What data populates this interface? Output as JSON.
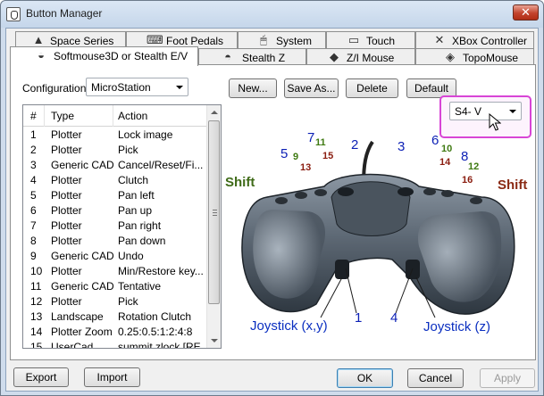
{
  "window": {
    "title": "Button Manager"
  },
  "tabs_row1": [
    {
      "label": "Space Series",
      "icon": "spacemouse-icon"
    },
    {
      "label": "Foot Pedals",
      "icon": "pedal-icon"
    },
    {
      "label": "System",
      "icon": "mouse-icon"
    },
    {
      "label": "Touch",
      "icon": "monitor-icon"
    },
    {
      "label": "XBox Controller",
      "icon": "gamepad-icon"
    }
  ],
  "tabs_row2": [
    {
      "label": "Softmouse3D or Stealth E/V",
      "icon": "softmouse-icon",
      "active": true
    },
    {
      "label": "Stealth Z",
      "icon": "stealth-icon"
    },
    {
      "label": "Z/I Mouse",
      "icon": "zi-mouse-icon"
    },
    {
      "label": "TopoMouse",
      "icon": "topomouse-icon"
    }
  ],
  "configuration": {
    "label": "Configuration",
    "value": "MicroStation"
  },
  "buttons": {
    "new": "New...",
    "save_as": "Save As...",
    "delete": "Delete",
    "default": "Default"
  },
  "model_select": {
    "value": "S4- V"
  },
  "list": {
    "columns": [
      "#",
      "Type",
      "Action"
    ],
    "rows": [
      [
        "1",
        "Plotter",
        "Lock image"
      ],
      [
        "2",
        "Plotter",
        "Pick"
      ],
      [
        "3",
        "Generic CAD",
        "Cancel/Reset/Fi..."
      ],
      [
        "4",
        "Plotter",
        "Clutch"
      ],
      [
        "5",
        "Plotter",
        "Pan left"
      ],
      [
        "6",
        "Plotter",
        "Pan up"
      ],
      [
        "7",
        "Plotter",
        "Pan right"
      ],
      [
        "8",
        "Plotter",
        "Pan down"
      ],
      [
        "9",
        "Generic CAD",
        "Undo"
      ],
      [
        "10",
        "Plotter",
        "Min/Restore key..."
      ],
      [
        "11",
        "Generic CAD",
        "Tentative"
      ],
      [
        "12",
        "Plotter",
        "Pick"
      ],
      [
        "13",
        "Landscape",
        "Rotation Clutch"
      ],
      [
        "14",
        "Plotter Zoom",
        "0.25:0.5:1:2:4:8"
      ],
      [
        "15",
        "UserCad",
        "summit zlock [RE"
      ]
    ]
  },
  "callouts": {
    "shift_left": "Shift",
    "shift_right": "Shift",
    "n1": "1",
    "n2": "2",
    "n3": "3",
    "n4": "4",
    "n5": "5",
    "n6": "6",
    "n7": "7",
    "n8": "8",
    "n9": "9",
    "n10": "10",
    "n11": "11",
    "n12": "12",
    "n13": "13",
    "n14": "14",
    "n15": "15",
    "n16": "16",
    "joystick_xy": "Joystick (x,y)",
    "joystick_z": "Joystick (z)"
  },
  "footer": {
    "export": "Export",
    "import": "Import",
    "ok": "OK",
    "cancel": "Cancel",
    "apply": "Apply"
  },
  "colors": {
    "callout_blue": "#0b1fb5",
    "callout_green": "#3f7a12",
    "callout_red": "#8a1c0f",
    "highlight": "#d845d6"
  }
}
